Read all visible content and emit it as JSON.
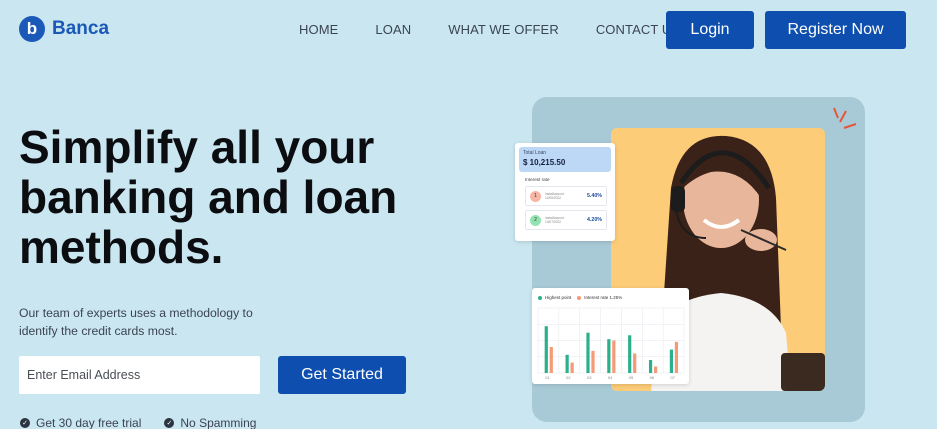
{
  "brand": {
    "name": "Banca",
    "logo_letter": "b",
    "color": "#1a59b8"
  },
  "nav": {
    "items": [
      "HOME",
      "LOAN",
      "WHAT WE OFFER",
      "CONTACT US"
    ],
    "login_label": "Login",
    "register_label": "Register Now"
  },
  "hero": {
    "title": "Simplify all your banking and loan methods.",
    "subtitle": "Our team of experts uses a methodology to identify the credit cards most.",
    "email_placeholder": "Enter Email Address",
    "cta_label": "Get Started",
    "perks": [
      "Get 30 day free trial",
      "No Spamming"
    ]
  },
  "loan_card": {
    "total_label": "Total Loan",
    "total_value": "$ 10,215.50",
    "interest_label": "Interest rate",
    "rows": [
      {
        "num": "1",
        "title": "InstalAmount",
        "date": "12/06/2022",
        "rate": "5.40%",
        "color": "#f6b6a6"
      },
      {
        "num": "2",
        "title": "InstalAmount",
        "date": "13/07/2022",
        "rate": "4.20%",
        "color": "#93e3b2"
      }
    ]
  },
  "chart_card": {
    "legend": [
      {
        "name": "Highest point",
        "color": "#2ab08a"
      },
      {
        "name": "Interest rate 1.25%",
        "color": "#f59a76"
      }
    ],
    "categories": [
      "01",
      "02",
      "03",
      "04",
      "05",
      "06",
      "07"
    ]
  },
  "chart_data": {
    "type": "bar",
    "categories": [
      "01",
      "02",
      "03",
      "04",
      "05",
      "06",
      "07"
    ],
    "series": [
      {
        "name": "Highest point",
        "values": [
          72,
          28,
          62,
          52,
          58,
          20,
          36
        ]
      },
      {
        "name": "Interest rate 1.25%",
        "values": [
          40,
          16,
          34,
          50,
          30,
          10,
          48
        ]
      }
    ],
    "ylim": [
      0,
      100
    ],
    "grid": true,
    "legend_placement": "top-left"
  }
}
